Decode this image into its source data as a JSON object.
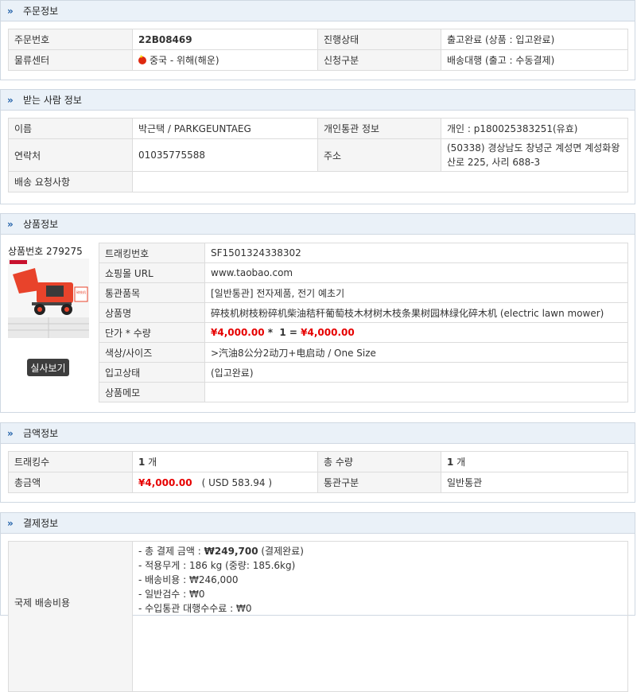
{
  "order": {
    "title": "주문정보",
    "rows": [
      [
        "주문번호",
        "22B08469",
        "진행상태",
        "출고완료 (상품 : 입고완료)"
      ],
      [
        "물류센터",
        "중국 - 위해(해운)",
        "신청구분",
        "배송대행 (출고 : 수동결제)"
      ]
    ]
  },
  "recipient": {
    "title": "받는 사람 정보",
    "name_label": "이름",
    "name": "박근택 / PARKGEUNTAEG",
    "customs_label": "개인통관 정보",
    "customs": "개인 : p180025383251(유효)",
    "phone_label": "연락처",
    "phone": "01035775588",
    "address_label": "주소",
    "address": "(50338) 경상남도 창녕군 계성면 계성화왕산로 225, 사리 688-3",
    "request_label": "배송 요청사항",
    "request": ""
  },
  "product": {
    "title": "상품정보",
    "number_text": "상품번호 279275",
    "photo_button": "실사보기",
    "image_caption": "碎枝机",
    "rows": {
      "tracking_label": "트래킹번호",
      "tracking": "SF1501324338302",
      "mall_label": "쇼핑몰 URL",
      "mall": "www.taobao.com",
      "category_label": "통관품목",
      "category": "[일반통관] 전자제품, 전기 예초기",
      "name_label": "상품명",
      "name": "碎枝机树枝粉碎机柴油秸秆葡萄枝木材树木枝条果树园林绿化碎木机 (electric lawn mower)",
      "price_label": "단가 * 수량",
      "price_unit": "¥4,000.00",
      "price_op": " *  1 = ",
      "price_total": "¥4,000.00",
      "option_label": "색상/사이즈",
      "option": ">汽油8公分2动刀+电启动 / One Size",
      "status_label": "입고상태",
      "status": "(입고완료)",
      "memo_label": "상품메모",
      "memo": ""
    }
  },
  "amount": {
    "title": "금액정보",
    "tracking_count_label": "트래킹수",
    "tracking_count_num": "1",
    "tracking_count_unit": " 개",
    "total_qty_label": "총 수량",
    "total_qty_num": "1",
    "total_qty_unit": " 개",
    "total_label": "총금액",
    "total": "¥4,000.00",
    "total_usd": "( USD 583.94 )",
    "customs_label": "통관구분",
    "customs": "일반통관"
  },
  "payment": {
    "title": "결제정보",
    "label": "국제 배송비용",
    "line1_prefix": "- 총 결제 금액 : ",
    "line1_amount": "₩249,700",
    "line1_suffix": " (결제완료)",
    "line2": "- 적용무게 : 186 kg (중량: 185.6kg)",
    "line3": "- 배송비용 : ₩246,000",
    "line4": "- 일반검수 : ₩0",
    "line5": "- 수입통관 대행수수료 : ₩0"
  },
  "colors": {
    "header_bg": "#eaf1f8",
    "accent": "#1f5fa8",
    "price_red": "#e60000",
    "link_blue": "#3a66b7"
  }
}
